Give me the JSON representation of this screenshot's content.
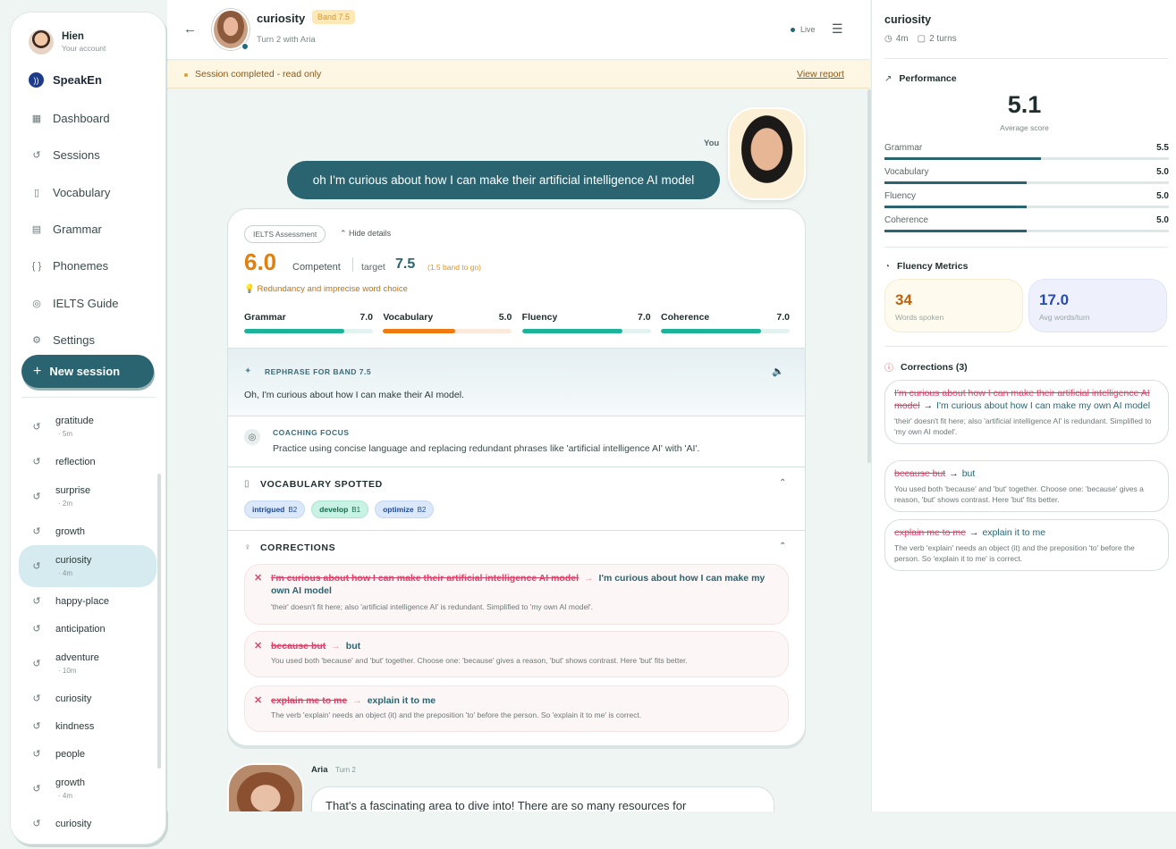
{
  "account": {
    "name": "Hien",
    "sub": "Your account"
  },
  "brand": {
    "name": "SpeakEn",
    "logo": "))"
  },
  "nav": [
    {
      "label": "Dashboard",
      "icon": "grid-icon",
      "glyph": "▦"
    },
    {
      "label": "Sessions",
      "icon": "history-icon",
      "glyph": "↺"
    },
    {
      "label": "Vocabulary",
      "icon": "book-icon",
      "glyph": "▯"
    },
    {
      "label": "Grammar",
      "icon": "notebook-icon",
      "glyph": "▤"
    },
    {
      "label": "Phonemes",
      "icon": "braces-icon",
      "glyph": "{ }"
    },
    {
      "label": "IELTS Guide",
      "icon": "target-icon",
      "glyph": "◎"
    },
    {
      "label": "Settings",
      "icon": "gear-icon",
      "glyph": "⚙"
    }
  ],
  "new_session": {
    "label": "New session",
    "glyph": "+"
  },
  "sessions": [
    {
      "title": "gratitude",
      "dur": "5m"
    },
    {
      "title": "reflection",
      "dur": ""
    },
    {
      "title": "surprise",
      "dur": "2m"
    },
    {
      "title": "growth",
      "dur": ""
    },
    {
      "title": "curiosity",
      "dur": "4m",
      "active": true
    },
    {
      "title": "happy-place",
      "dur": ""
    },
    {
      "title": "anticipation",
      "dur": ""
    },
    {
      "title": "adventure",
      "dur": "10m"
    },
    {
      "title": "curiosity",
      "dur": ""
    },
    {
      "title": "kindness",
      "dur": ""
    },
    {
      "title": "people",
      "dur": ""
    },
    {
      "title": "growth",
      "dur": "4m"
    },
    {
      "title": "curiosity",
      "dur": ""
    }
  ],
  "header": {
    "title": "curiosity",
    "band": "Band 7.5",
    "sub": "Turn 2 with Aria",
    "live": "Live"
  },
  "banner": {
    "text": "Session completed - read only",
    "link": "View report"
  },
  "user_msg": {
    "label": "You",
    "text": "oh I'm curious about how I can make their artificial intelligence AI model"
  },
  "assessment": {
    "pill": "IELTS Assessment",
    "hide": "Hide details",
    "score": "6.0",
    "score_label": "Competent",
    "target_label": "target",
    "target": "7.5",
    "to_go": "(1.5 band to go)",
    "hint": "Redundancy and imprecise word choice",
    "bars": [
      {
        "name": "Grammar",
        "value": "7.0",
        "fraction": 0.78,
        "color": "teal"
      },
      {
        "name": "Vocabulary",
        "value": "5.0",
        "fraction": 0.56,
        "color": "orange"
      },
      {
        "name": "Fluency",
        "value": "7.0",
        "fraction": 0.78,
        "color": "teal"
      },
      {
        "name": "Coherence",
        "value": "7.0",
        "fraction": 0.78,
        "color": "teal"
      }
    ],
    "rephrase_label": "REPHRASE FOR BAND 7.5",
    "rephrase_text": "Oh, I'm curious about how I can make their AI model.",
    "coach_label": "COACHING FOCUS",
    "coach_text": "Practice using concise language and replacing redundant phrases like 'artificial intelligence AI' with 'AI'.",
    "vocab_label": "VOCABULARY SPOTTED",
    "vocab": [
      {
        "word": "intrigued",
        "level": "B2"
      },
      {
        "word": "develop",
        "level": "B1"
      },
      {
        "word": "optimize",
        "level": "B2"
      }
    ],
    "corrections_label": "CORRECTIONS"
  },
  "corrections": [
    {
      "wrong": "I'm curious about how I can make their artificial intelligence AI model",
      "right": "I'm curious about how I can make my own AI model",
      "exp": "'their' doesn't fit here; also 'artificial intelligence AI' is redundant. Simplified to 'my own AI model'."
    },
    {
      "wrong": "because but",
      "right": "but",
      "exp": "You used both 'because' and 'but' together. Choose one: 'because' gives a reason, 'but' shows contrast. Here 'but' fits better."
    },
    {
      "wrong": "explain me to me",
      "right": "explain it to me",
      "exp": "The verb 'explain' needs an object (it) and the preposition 'to' before the person. So 'explain it to me' is correct."
    }
  ],
  "aria": {
    "name": "Aria",
    "turn": "Turn 2",
    "text": "That's a fascinating area to dive into! There are so many resources for"
  },
  "right": {
    "title": "curiosity",
    "duration": "4m",
    "turns": "2 turns",
    "performance_label": "Performance",
    "avg": "5.1",
    "avg_label": "Average score",
    "perf": [
      {
        "name": "Grammar",
        "value": "5.5",
        "fraction": 0.55
      },
      {
        "name": "Vocabulary",
        "value": "5.0",
        "fraction": 0.5
      },
      {
        "name": "Fluency",
        "value": "5.0",
        "fraction": 0.5
      },
      {
        "name": "Coherence",
        "value": "5.0",
        "fraction": 0.5
      }
    ],
    "fluency_label": "Fluency Metrics",
    "words": "34",
    "words_label": "Words spoken",
    "avg_words": "17.0",
    "avg_words_label": "Avg words/turn",
    "corrections_label": "Corrections (3)"
  },
  "colors": {
    "primary": "#2a6470",
    "accent_orange": "#e08010",
    "teal_bar": "#1db39a",
    "error": "#e0406a"
  }
}
